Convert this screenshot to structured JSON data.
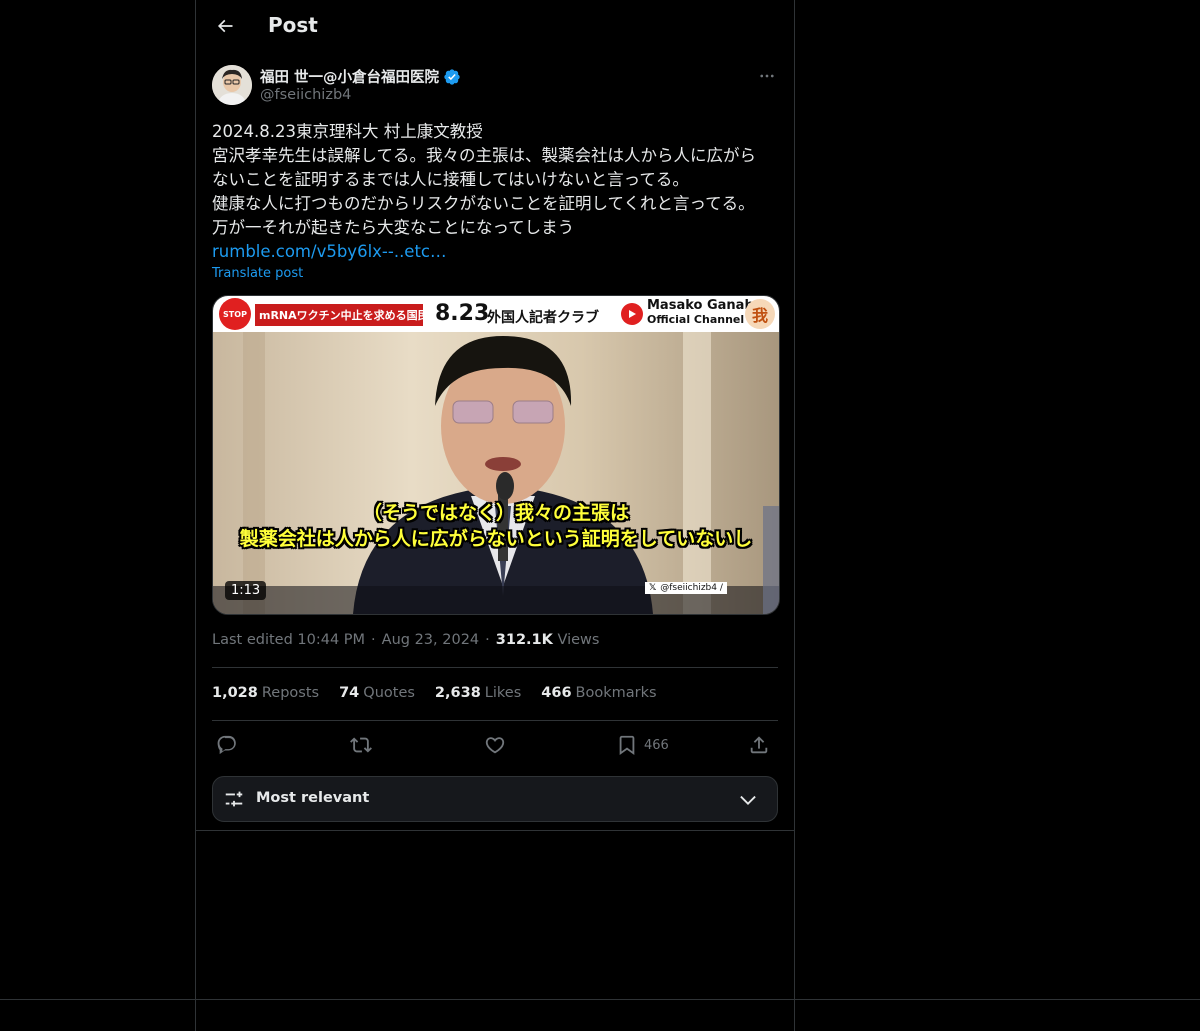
{
  "header": {
    "title": "Post",
    "back_icon": "arrow-left-icon"
  },
  "author": {
    "display_name": "福田 世一@小倉台福田医院",
    "handle": "@fseiichizb4",
    "verified": true
  },
  "post": {
    "text": "2024.8.23東京理科大 村上康文教授\n宮沢孝幸先生は誤解してる。我々の主張は、製薬会社は人から人に広がら\nないことを証明するまでは人に接種してはいけないと言ってる。\n健康な人に打つものだからリスクがないことを証明してくれと言ってる。\n万が一それが起きたら大変なことになってしまう",
    "link": "rumble.com/v5by6lx--..etc…",
    "translate_label": "Translate post"
  },
  "media": {
    "banner_stop": "STOP",
    "banner_org": "mRNAワクチン中止を求める国民連合",
    "banner_date": "8.23",
    "banner_club": "外国人記者クラブ",
    "banner_channel": "Masako Ganaha",
    "banner_channel_sub": "Official Channel",
    "banner_seal": "我",
    "subtitle_line1": "（そうではなく）我々の主張は",
    "subtitle_line2": "製薬会社は人から人に広がらないという証明をしていないし",
    "duration": "1:13",
    "watermark": "@fseiichizb4 /"
  },
  "meta": {
    "edited": "Last edited 10:44 PM",
    "date": "Aug 23, 2024",
    "views_count": "312.1K",
    "views_label": "Views",
    "separator": "·"
  },
  "stats": {
    "reposts_count": "1,028",
    "reposts_label": "Reposts",
    "quotes_count": "74",
    "quotes_label": "Quotes",
    "likes_count": "2,638",
    "likes_label": "Likes",
    "bookmarks_count": "466",
    "bookmarks_label": "Bookmarks"
  },
  "actions": {
    "bookmark_count": "466"
  },
  "filter": {
    "label": "Most relevant"
  },
  "colors": {
    "accent": "#1d9bf0",
    "background": "#000000",
    "border": "#2f3336",
    "muted": "#71767b",
    "subtitle": "#ffff3a"
  }
}
